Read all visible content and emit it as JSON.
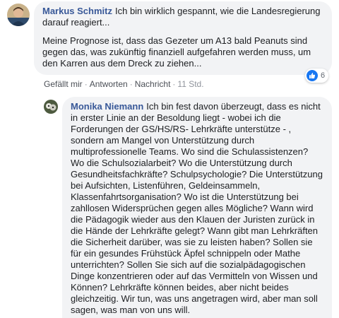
{
  "comment": {
    "author": "Markus Schmitz",
    "paragraphs": [
      "Ich bin wirklich gespannt, wie die Landesregierung darauf reagiert...",
      "Meine Prognose ist, dass das Gezeter um A13 bald Peanuts sind gegen das, was zukünftig finanziell aufgefahren werden muss, um den Karren aus dem Dreck zu ziehen..."
    ],
    "reaction_count": "6",
    "reaction_icon": "like-icon",
    "actions": {
      "like": "Gefällt mir",
      "reply": "Antworten",
      "message": "Nachricht",
      "timestamp": "11 Std."
    }
  },
  "reply": {
    "author": "Monika Niemann",
    "text": "Ich bin fest davon überzeugt, dass es nicht in erster Linie an der Besoldung liegt - wobei ich die Forderungen der GS/HS/RS- Lehrkräfte unterstütze - , sondern am Mangel von Unterstützung durch multiprofessionelle Teams. Wo sind die Schulassistenzen? Wo die Schulsozialarbeit? Wo die Unterstützung durch Gesundheitsfachkräfte? Schulpsychologie? Die Unterstützung bei Aufsichten, Listenführen, Geldeinsammeln, Klassenfahrtsorganisation? Wo ist die Unterstützung bei zahllosen Widersprüchen gegen alles Mögliche? Wann wird die Pädagogik wieder aus den Klauen der Juristen zurück in die Hände der Lehrkräfte gelegt? Wann gibt man Lehrkräften die Sicherheit darüber, was sie zu leisten haben? Sollen sie für ein gesundes Frühstück Äpfel schnippeln oder Mathe unterrichten? Sollen Sie sich auf die sozialpädagogischen Dinge konzentrieren oder auf das Vermitteln von Wissen und Können? Lehrkräfte können beides, aber nicht beides gleichzeitig. Wir tun, was uns angetragen wird, aber man soll sagen, was man von uns will."
  },
  "colors": {
    "author_link": "#385898",
    "bubble_bg": "#f2f3f5",
    "like_blue": "#1877f2",
    "meta_gray": "#90949c"
  }
}
